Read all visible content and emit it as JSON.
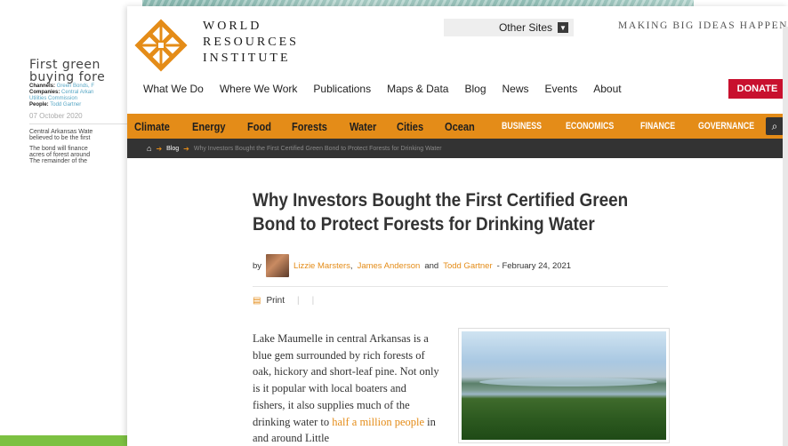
{
  "background_article": {
    "title": "First green\nbuying fore",
    "channels_label": "Channels:",
    "channels_value": "Green Bonds, F",
    "companies_label": "Companies:",
    "companies_value": "Central Arkan",
    "companies_value2": "Utilities Commission",
    "people_label": "People:",
    "people_value": "Todd Gartner",
    "date": "07 October 2020",
    "para1": "Central Arkansas Wate\nbelieved to be the first",
    "para2": "The bond will finance\nacres of forest around\nThe remainder of the"
  },
  "header": {
    "logo_lines": [
      "WORLD",
      "RESOURCES",
      "INSTITUTE"
    ],
    "other_sites": "Other Sites",
    "tagline": "MAKING BIG IDEAS HAPPEN",
    "donate": "DONATE"
  },
  "top_nav": [
    "What We Do",
    "Where We Work",
    "Publications",
    "Maps & Data",
    "Blog",
    "News",
    "Events",
    "About"
  ],
  "category_bar": {
    "topics": [
      "Climate",
      "Energy",
      "Food",
      "Forests",
      "Water",
      "Cities",
      "Ocean"
    ],
    "centers": [
      "BUSINESS",
      "ECONOMICS",
      "FINANCE",
      "GOVERNANCE"
    ]
  },
  "breadcrumb": {
    "blog": "Blog",
    "current": "Why Investors Bought the First Certified Green Bond to Protect Forests for Drinking Water"
  },
  "article": {
    "title": "Why Investors Bought the First Certified Green Bond to Protect Forests for Drinking Water",
    "by": "by",
    "author1": "Lizzie Marsters",
    "sep1": ",",
    "author2": "James Anderson",
    "and": "and",
    "author3": "Todd Gartner",
    "date": "- February 24, 2021",
    "print": "Print",
    "body_start": "Lake Maumelle in central Arkansas is a blue gem surrounded by rich forests of oak, hickory and short-leaf pine. Not only is it popular with local boaters and fishers, it also supplies much of the drinking water to ",
    "body_link": "half a million people",
    "body_end": " in and around Little"
  },
  "colors": {
    "accent_orange": "#e48c18",
    "donate_red": "#c8102e",
    "breadcrumb_bg": "#333333",
    "bg_green_bar": "#7cc142"
  },
  "icons": {
    "logo": "wri-logo-icon",
    "dropdown": "chevron-down-icon",
    "search": "search-icon",
    "home": "home-icon",
    "print": "print-icon"
  }
}
